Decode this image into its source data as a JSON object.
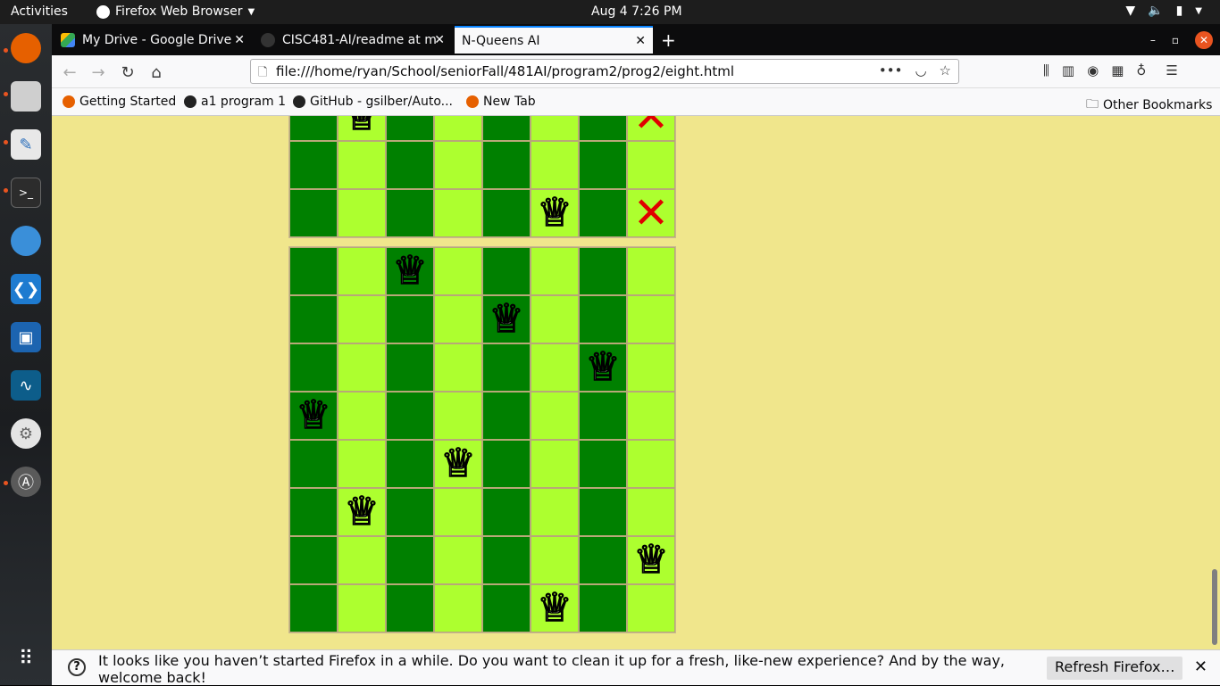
{
  "topbar": {
    "activities": "Activities",
    "app_name": "Firefox Web Browser",
    "clock": "Aug 4  7:26 PM"
  },
  "dock": {
    "items": [
      "firefox-icon",
      "files-icon",
      "text-editor-icon",
      "terminal-icon",
      "web-app-icon",
      "vscode-icon",
      "virtualbox-icon",
      "matlab-icon",
      "settings-icon",
      "software-updater-icon"
    ],
    "apps_grid": "show-applications-icon"
  },
  "tabs": [
    {
      "label": "My Drive - Google Drive",
      "active": false
    },
    {
      "label": "CISC481-AI/readme at m",
      "active": false
    },
    {
      "label": "N-Queens AI",
      "active": true
    }
  ],
  "nav": {
    "url": "file:///home/ryan/School/seniorFall/481AI/program2/prog2/eight.html"
  },
  "bookmarks": {
    "items": [
      "Getting Started",
      "a1 program 1",
      "GitHub - gsilber/Auto...",
      "New Tab"
    ],
    "other": "Other Bookmarks"
  },
  "boards": [
    {
      "visible_rows": 3,
      "queens": [
        [
          0,
          1
        ],
        [
          2,
          5
        ]
      ],
      "marks": [
        [
          0,
          7
        ],
        [
          2,
          7
        ]
      ]
    },
    {
      "visible_rows": 8,
      "queens": [
        [
          0,
          2
        ],
        [
          1,
          4
        ],
        [
          2,
          6
        ],
        [
          3,
          0
        ],
        [
          4,
          3
        ],
        [
          5,
          1
        ],
        [
          6,
          7
        ],
        [
          7,
          5
        ]
      ],
      "marks": []
    }
  ],
  "notification": {
    "message": "It looks like you haven’t started Firefox in a while. Do you want to clean it up for a fresh, like-new experience? And by the way, welcome back!",
    "button": "Refresh Firefox…"
  },
  "colors": {
    "dark_square": "#008000",
    "light_square": "#adff2f",
    "background": "#f0e68c",
    "mark": "#e00000"
  }
}
